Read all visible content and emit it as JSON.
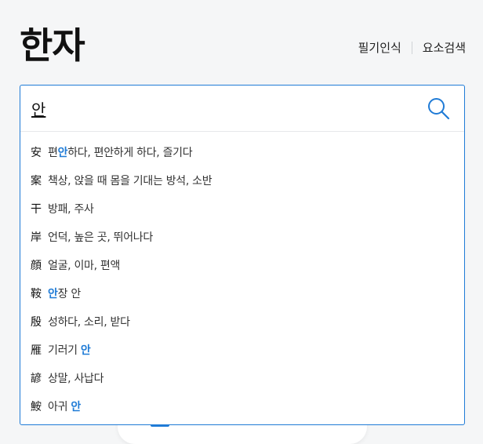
{
  "header": {
    "title": "한자",
    "links": [
      "필기인식",
      "요소검색"
    ]
  },
  "search": {
    "value": "안"
  },
  "suggestions": [
    {
      "hanja": "安",
      "parts": [
        {
          "t": "편",
          "h": false
        },
        {
          "t": "안",
          "h": true
        },
        {
          "t": "하다, 편안하게 하다, 즐기다",
          "h": false
        }
      ]
    },
    {
      "hanja": "案",
      "parts": [
        {
          "t": "책상, 앉을 때 몸을 기대는 방석, 소반",
          "h": false
        }
      ]
    },
    {
      "hanja": "干",
      "parts": [
        {
          "t": "방패, 주사",
          "h": false
        }
      ]
    },
    {
      "hanja": "岸",
      "parts": [
        {
          "t": "언덕, 높은 곳, 뛰어나다",
          "h": false
        }
      ]
    },
    {
      "hanja": "顔",
      "parts": [
        {
          "t": "얼굴, 이마, 편액",
          "h": false
        }
      ]
    },
    {
      "hanja": "鞍",
      "parts": [
        {
          "t": "안",
          "h": true
        },
        {
          "t": "장 안",
          "h": false
        }
      ]
    },
    {
      "hanja": "殷",
      "parts": [
        {
          "t": "성하다, 소리, 받다",
          "h": false
        }
      ]
    },
    {
      "hanja": "雁",
      "parts": [
        {
          "t": "기러기 ",
          "h": false
        },
        {
          "t": "안",
          "h": true
        }
      ]
    },
    {
      "hanja": "諺",
      "parts": [
        {
          "t": "상말, 사납다",
          "h": false
        }
      ]
    },
    {
      "hanja": "鮟",
      "parts": [
        {
          "t": "아귀 ",
          "h": false
        },
        {
          "t": "안",
          "h": true
        }
      ]
    }
  ],
  "colors": {
    "accent": "#1f7bd6",
    "background": "#f5f6f7"
  }
}
